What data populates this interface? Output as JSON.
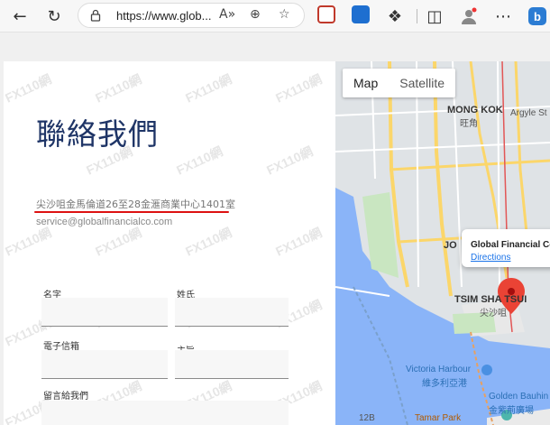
{
  "browser": {
    "url": "https://www.glob...",
    "read_aloud_icon": "A»"
  },
  "page": {
    "title": "聯絡我們",
    "address": "尖沙咀金馬倫道26至28金滙商業中心1401室",
    "email": "service@globalfinancialco.com",
    "watermark": "FX110網",
    "form": {
      "first_name_label": "名字",
      "last_name_label": "姓氏",
      "email_label": "電子信箱",
      "subject_label": "主旨",
      "message_label": "留言給我們"
    }
  },
  "map": {
    "tab_map": "Map",
    "tab_satellite": "Satellite",
    "info_title": "Global Financial Co.",
    "info_link": "Directions",
    "labels": {
      "mong_kok": "MONG KOK",
      "mong_kok_zh": "旺角",
      "argyle": "Argyle St",
      "jordan": "JO",
      "tsim_sha_tsui": "TSIM SHA TSUI",
      "tsim_sha_tsui_zh": "尖沙咀",
      "victoria_harbour": "Victoria Harbour",
      "victoria_harbour_zh": "維多利亞港",
      "golden_bauhinia": "Golden Bauhin",
      "golden_bauhinia_zh": "金紫荊廣場",
      "tamar_park": "Tamar Park",
      "route_128": "12B"
    }
  },
  "colors": {
    "title": "#1f3567",
    "underline": "#dd1111",
    "map_water": "#8ab4f8",
    "pin": "#ea4335"
  }
}
